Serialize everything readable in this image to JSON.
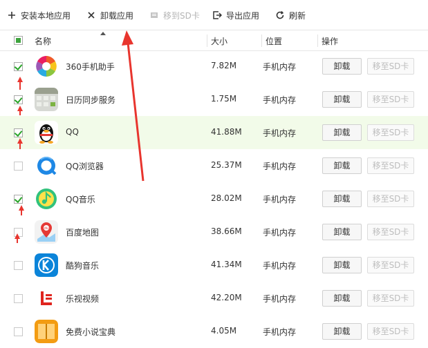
{
  "toolbar": {
    "install_label": "安装本地应用",
    "uninstall_label": "卸载应用",
    "move_sd_label": "移到SD卡",
    "export_label": "导出应用",
    "refresh_label": "刷新"
  },
  "table": {
    "headers": {
      "name": "名称",
      "size": "大小",
      "location": "位置",
      "action": "操作"
    },
    "header_checked": true,
    "rows": [
      {
        "name": "360手机助手",
        "size": "7.82M",
        "location": "手机内存",
        "checked": true,
        "icon": "360-assistant-icon",
        "uninstall": "卸载",
        "move_sd": "移至SD卡"
      },
      {
        "name": "日历同步服务",
        "size": "1.75M",
        "location": "手机内存",
        "checked": true,
        "icon": "calendar-sync-icon",
        "uninstall": "卸载",
        "move_sd": "移至SD卡"
      },
      {
        "name": "QQ",
        "size": "41.88M",
        "location": "手机内存",
        "checked": true,
        "icon": "qq-penguin-icon",
        "uninstall": "卸载",
        "move_sd": "移至SD卡",
        "highlighted": true
      },
      {
        "name": "QQ浏览器",
        "size": "25.37M",
        "location": "手机内存",
        "checked": false,
        "icon": "qq-browser-icon",
        "uninstall": "卸载",
        "move_sd": "移至SD卡"
      },
      {
        "name": "QQ音乐",
        "size": "28.02M",
        "location": "手机内存",
        "checked": true,
        "icon": "qq-music-icon",
        "uninstall": "卸载",
        "move_sd": "移至SD卡"
      },
      {
        "name": "百度地图",
        "size": "38.66M",
        "location": "手机内存",
        "checked": false,
        "icon": "baidu-map-icon",
        "uninstall": "卸载",
        "move_sd": "移至SD卡"
      },
      {
        "name": "酷狗音乐",
        "size": "41.34M",
        "location": "手机内存",
        "checked": false,
        "icon": "kugou-music-icon",
        "uninstall": "卸载",
        "move_sd": "移至SD卡"
      },
      {
        "name": "乐视视频",
        "size": "42.20M",
        "location": "手机内存",
        "checked": false,
        "icon": "letv-video-icon",
        "uninstall": "卸载",
        "move_sd": "移至SD卡"
      },
      {
        "name": "免费小说宝典",
        "size": "4.05M",
        "location": "手机内存",
        "checked": false,
        "icon": "novel-book-icon",
        "uninstall": "卸载",
        "move_sd": "移至SD卡"
      }
    ]
  },
  "colors": {
    "annotation_red": "#e8352e",
    "check_green": "#2aa52a",
    "row_highlight": "#f2fbe9"
  }
}
